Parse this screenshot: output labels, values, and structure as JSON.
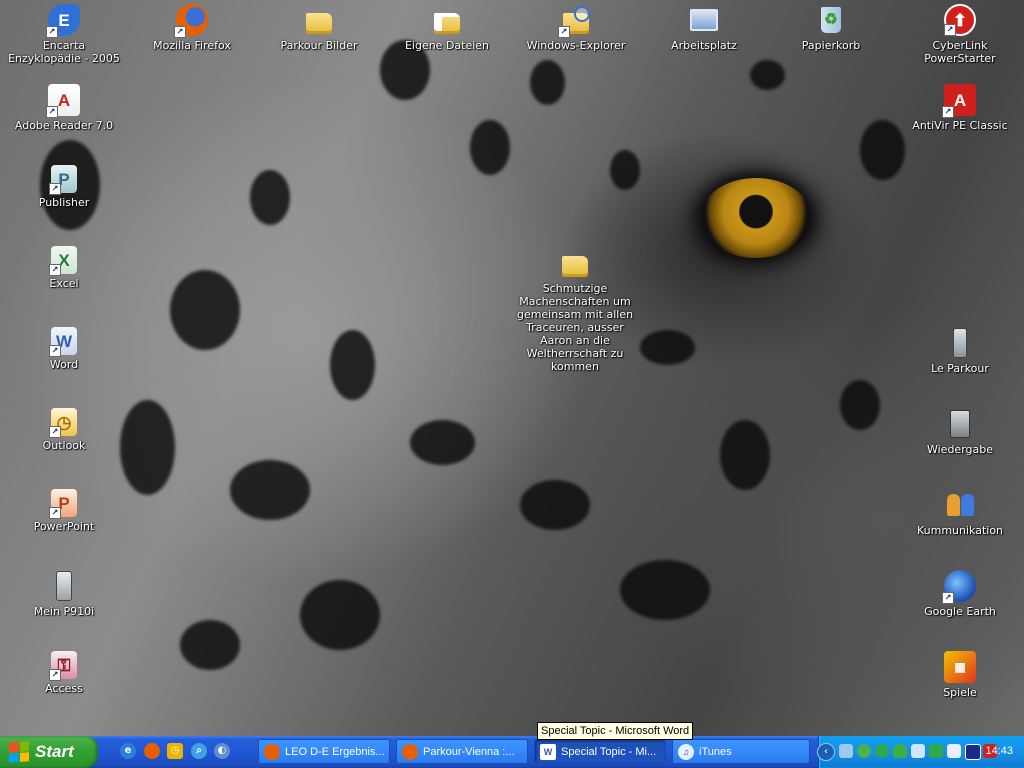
{
  "desktop": {
    "icons": [
      {
        "label": "Encarta Enzyklopädie - 2005",
        "icon": "encarta-icon",
        "color": "#2f6fd6"
      },
      {
        "label": "Mozilla Firefox",
        "icon": "firefox-icon",
        "color": "#e66000"
      },
      {
        "label": "Parkour Bilder",
        "icon": "folder-icon",
        "color": "#e6b935"
      },
      {
        "label": "Eigene Dateien",
        "icon": "my-documents-icon",
        "color": "#e6b935"
      },
      {
        "label": "Windows-Explorer",
        "icon": "explorer-icon",
        "color": "#e6b935"
      },
      {
        "label": "Arbeitsplatz",
        "icon": "my-computer-icon",
        "color": "#7aa3d8"
      },
      {
        "label": "Papierkorb",
        "icon": "recycle-bin-icon",
        "color": "#6fb04a"
      },
      {
        "label": "CyberLink PowerStarter",
        "icon": "cyberlink-icon",
        "color": "#d0201b"
      },
      {
        "label": "Adobe Reader 7.0",
        "icon": "adobe-reader-icon",
        "color": "#d0201b"
      },
      {
        "label": "AntiVir PE Classic",
        "icon": "antivir-icon",
        "color": "#d0201b"
      },
      {
        "label": "Publisher",
        "icon": "publisher-icon",
        "color": "#2a8a8a"
      },
      {
        "label": "Excel",
        "icon": "excel-icon",
        "color": "#1e7a3a"
      },
      {
        "label": "Word",
        "icon": "word-icon",
        "color": "#2b5db8"
      },
      {
        "label": "Outlook",
        "icon": "outlook-icon",
        "color": "#e0a420"
      },
      {
        "label": "PowerPoint",
        "icon": "powerpoint-icon",
        "color": "#d2551f"
      },
      {
        "label": "Mein P910i",
        "icon": "phone-icon",
        "color": "#bfc5c9"
      },
      {
        "label": "Access",
        "icon": "access-icon",
        "color": "#a0283c"
      },
      {
        "label": "Schmutzige Machenschaften um gemeinsam mit allen Traceuren, ausser Aaron an die Weltherrschaft zu kommen",
        "icon": "folder-icon",
        "color": "#e6b935"
      },
      {
        "label": "Le Parkour",
        "icon": "phone-icon",
        "color": "#bfc5c9"
      },
      {
        "label": "Wiedergabe",
        "icon": "media-player-icon",
        "color": "#9aa0a6"
      },
      {
        "label": "Kummunikation",
        "icon": "contacts-icon",
        "color": "#3d7be0"
      },
      {
        "label": "Google Earth",
        "icon": "google-earth-icon",
        "color": "#2a66c9"
      },
      {
        "label": "Spiele",
        "icon": "games-icon",
        "color": "#e0351f"
      }
    ]
  },
  "tooltip": "Special Topic - Microsoft Word",
  "taskbar": {
    "start_label": "Start",
    "quick_launch": [
      {
        "icon": "internet-explorer-icon",
        "color": "#2b7de0"
      },
      {
        "icon": "firefox-icon",
        "color": "#e66000"
      },
      {
        "icon": "clock-app-icon",
        "color": "#f0b400"
      },
      {
        "icon": "search-icon",
        "color": "#3fa0e8"
      },
      {
        "icon": "show-desktop-icon",
        "color": "#5b8ed6"
      }
    ],
    "tasks": [
      {
        "label": "LEO D-E Ergebnis...",
        "icon": "firefox-icon",
        "color": "#e66000",
        "active": false
      },
      {
        "label": "Parkour-Vienna :...",
        "icon": "firefox-icon",
        "color": "#e66000",
        "active": false
      },
      {
        "label": "Special Topic - Mi...",
        "icon": "word-icon",
        "color": "#2b5db8",
        "active": true
      },
      {
        "label": "iTunes",
        "icon": "itunes-icon",
        "color": "#5fa0e0",
        "active": false
      }
    ],
    "tray_icons": [
      {
        "icon": "tray-collapse-icon",
        "color": "#1a5fb4"
      },
      {
        "icon": "network-icon",
        "color": "#9ec8f0"
      },
      {
        "icon": "security-icon",
        "color": "#4caf50"
      },
      {
        "icon": "clover-icon",
        "color": "#2ea84a"
      },
      {
        "icon": "messenger-icon",
        "color": "#3cb043"
      },
      {
        "icon": "bluetooth-icon",
        "color": "#d0e6ff"
      },
      {
        "icon": "connection-icon",
        "color": "#2ea84a"
      },
      {
        "icon": "phone-sync-icon",
        "color": "#e8f0ff"
      },
      {
        "icon": "media-icon",
        "color": "#1c2a8a"
      },
      {
        "icon": "antivir-icon",
        "color": "#d0201b"
      }
    ],
    "clock": "14:43"
  }
}
